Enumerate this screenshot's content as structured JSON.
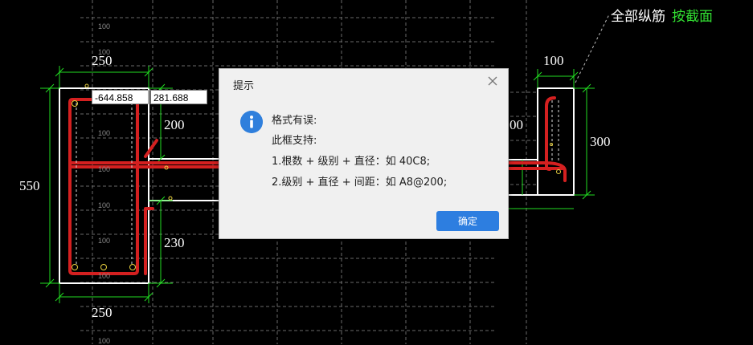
{
  "canvas": {
    "top_label_main": "全部纵筋",
    "top_label_accent": "按截面",
    "dims": {
      "left_top_width": "250",
      "left_bottom_width": "250",
      "left_height": "550",
      "web_top": "200",
      "web_bottom": "230",
      "right_top_width": "100",
      "right_height": "300",
      "right_partial": "00"
    },
    "grid_label": "100",
    "coord_x": "-644.858",
    "coord_y": "281.688",
    "colors": {
      "rebar": "#d42020",
      "outline": "#ffffff",
      "dimension": "#22dd22",
      "grid": "#6a6a6a",
      "accent": "#32e032"
    }
  },
  "dialog": {
    "title": "提示",
    "close_icon": "close-icon",
    "icon": "info-icon",
    "lines": [
      "格式有误:",
      "此框支持:",
      "1.根数 + 级别 + 直径：如 40C8;",
      "2.级别 + 直径 + 间距：如 A8@200;"
    ],
    "ok_label": "确定"
  }
}
